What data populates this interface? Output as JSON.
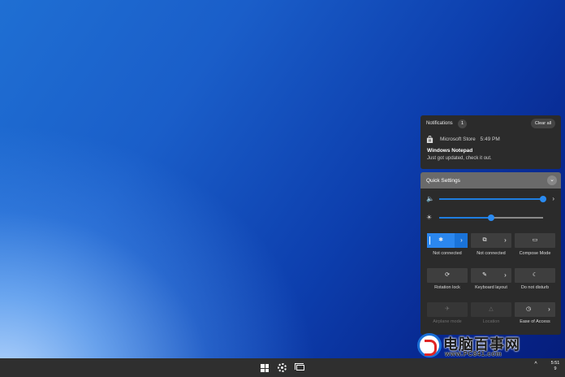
{
  "notifications": {
    "title": "Notifications",
    "count": "1",
    "clear_label": "Clear all",
    "items": [
      {
        "app": "Microsoft Store",
        "time": "5:49 PM",
        "heading": "Windows Notepad",
        "body": "Just got updated, check it out.",
        "icon": "store-icon"
      }
    ]
  },
  "quick_settings": {
    "title": "Quick Settings",
    "collapse_icon": "chevron-down-icon",
    "volume": {
      "icon": "speaker-icon",
      "value": 1.0
    },
    "brightness": {
      "icon": "brightness-icon",
      "value": 0.5
    },
    "tiles": [
      {
        "label": "Not connected",
        "icon": "bluetooth-icon",
        "state": "active",
        "split": true
      },
      {
        "label": "Not connected",
        "icon": "cast-icon",
        "state": "normal",
        "split": true
      },
      {
        "label": "Compose Mode",
        "icon": "compose-icon",
        "state": "normal",
        "split": false
      },
      {
        "label": "Rotation lock",
        "icon": "rotation-icon",
        "state": "normal",
        "split": false
      },
      {
        "label": "Keyboard layout",
        "icon": "keyboard-icon",
        "state": "normal",
        "split": true
      },
      {
        "label": "Do not disturb",
        "icon": "moon-icon",
        "state": "normal",
        "split": false
      },
      {
        "label": "Airplane mode",
        "icon": "airplane-icon",
        "state": "disabled",
        "split": false
      },
      {
        "label": "Location",
        "icon": "location-icon",
        "state": "disabled",
        "split": false
      },
      {
        "label": "Ease of Access",
        "icon": "ease-of-access-icon",
        "state": "normal",
        "split": true
      }
    ]
  },
  "watermark": {
    "title": "电脑百事网",
    "url": "www.PC841.com"
  },
  "taskbar": {
    "start_icon": "windows-logo-icon",
    "settings_icon": "gear-icon",
    "task_view_icon": "task-view-icon",
    "tray_arrow": "^",
    "clock_time": "5:51",
    "clock_sub": "9"
  }
}
